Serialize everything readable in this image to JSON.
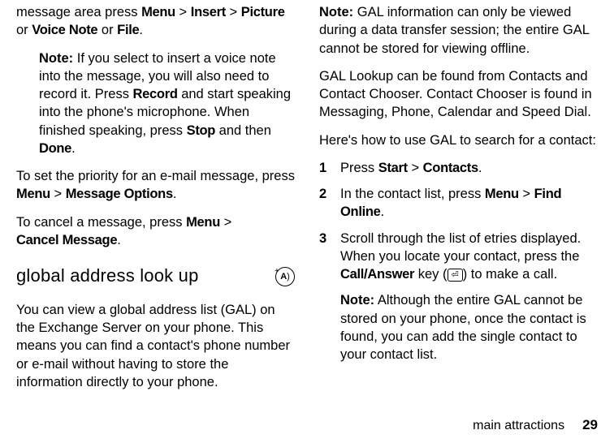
{
  "left": {
    "p1_pre": "message area press ",
    "p1_menu": "Menu",
    "p1_gt1": " > ",
    "p1_insert": "Insert",
    "p1_gt2": " > ",
    "p1_picture": "Picture",
    "p1_or1": " or ",
    "p1_voice": "Voice Note",
    "p1_or2": " or ",
    "p1_file": "File",
    "p1_period": ".",
    "note1_label": "Note:",
    "note1_a": " If you select to insert a voice note into the message, you will also need to record it. Press ",
    "note1_record": "Record",
    "note1_b": " and start speaking into the phone's microphone. When finished speaking, press ",
    "note1_stop": "Stop",
    "note1_c": " and then ",
    "note1_done": "Done",
    "note1_d": ".",
    "priority_a": "To set the priority for an e-mail message, press ",
    "priority_menu": "Menu",
    "priority_gt": " > ",
    "priority_opts": "Message Options",
    "priority_b": ".",
    "cancel_a": "To cancel a message, press ",
    "cancel_menu": "Menu",
    "cancel_gt": " > ",
    "cancel_msg": "Cancel Message",
    "cancel_b": ".",
    "heading": "global address look up",
    "gal_desc": "You can view a global address list (GAL) on the Exchange Server on your phone. This means you can find a contact's phone number or e-mail without having to store the information directly to your phone."
  },
  "right": {
    "note2_label": "Note:",
    "note2_body": " GAL information can only be viewed during a data transfer session; the entire GAL cannot be stored for viewing offline.",
    "p_lookup": "GAL Lookup can be found from Contacts and Contact Chooser. Contact Chooser is found in Messaging, Phone, Calendar and Speed Dial.",
    "p_howto": "Here's how to use GAL to search for a contact:",
    "s1_num": "1",
    "s1_a": "Press ",
    "s1_start": "Start",
    "s1_gt": " > ",
    "s1_contacts": "Contacts",
    "s1_b": ".",
    "s2_num": "2",
    "s2_a": "In the contact list, press ",
    "s2_menu": "Menu",
    "s2_gt": " > ",
    "s2_find": "Find Online",
    "s2_b": ".",
    "s3_num": "3",
    "s3_a": "Scroll through the list of etries displayed. When you locate your contact, press the ",
    "s3_call": "Call/Answer",
    "s3_b": " key (",
    "s3_key": "⏎",
    "s3_c": ") to make a call.",
    "note3_label": "Note:",
    "note3_body": " Although the entire GAL cannot be stored on your phone, once the contact is found, you can add the single contact to your contact list."
  },
  "footer": {
    "section": "main attractions",
    "page": "29"
  }
}
